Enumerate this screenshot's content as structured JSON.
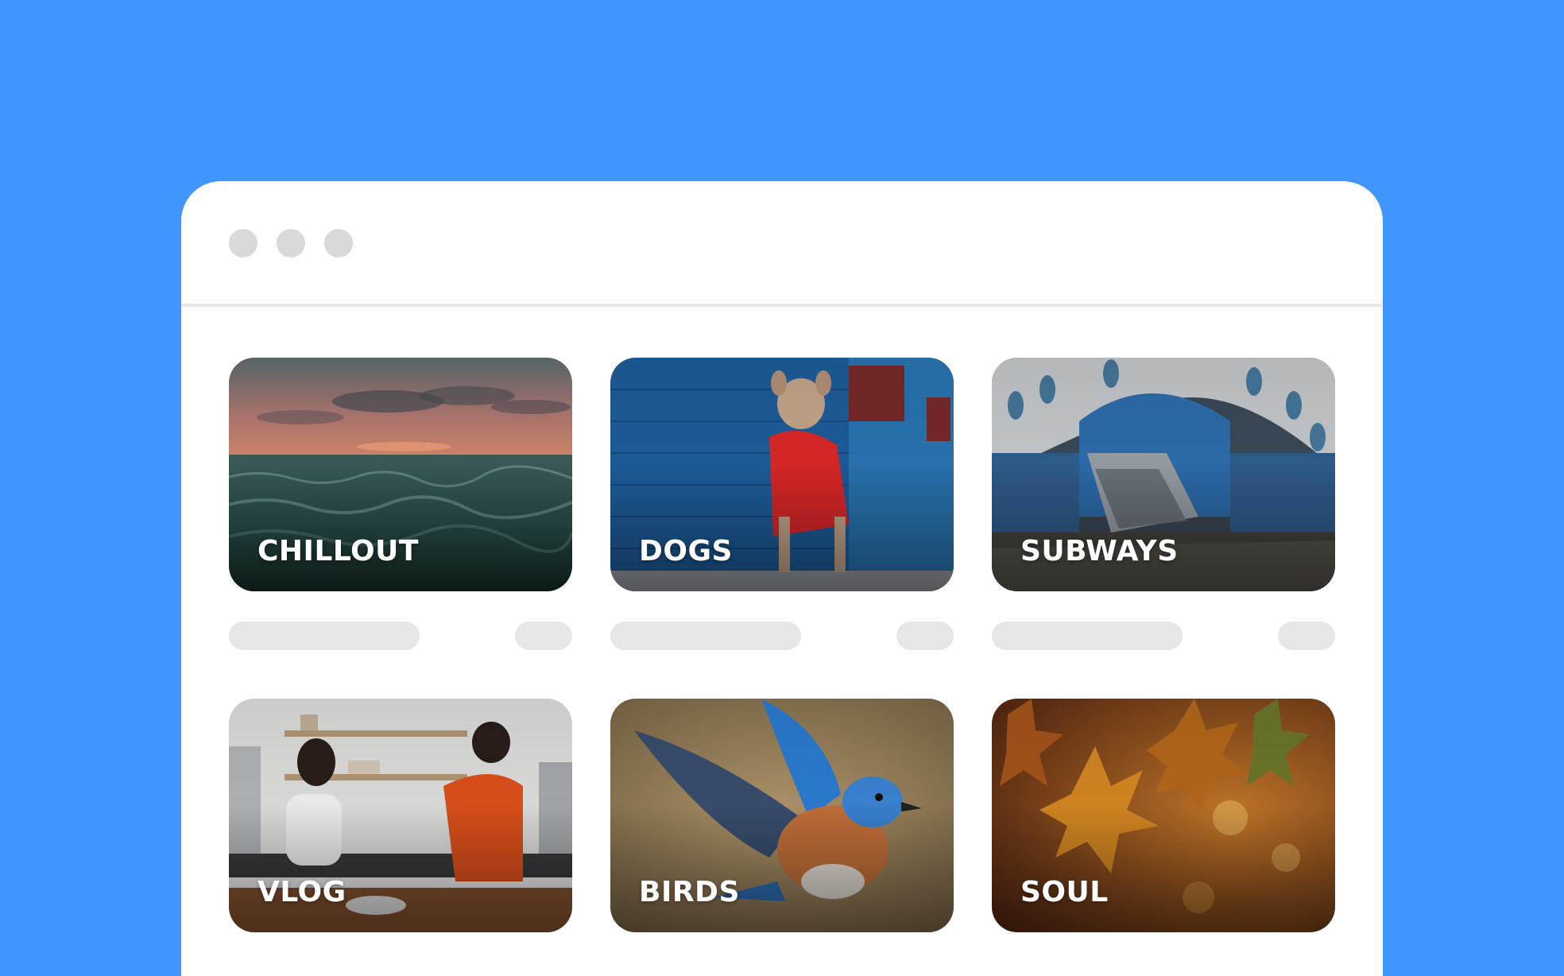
{
  "window": {
    "colors": {
      "background": "#4095FF",
      "window": "#FFFFFF",
      "placeholder": "#E7E7EA",
      "traffic_light": "#D9D9DB"
    }
  },
  "cards": [
    {
      "label": "CHILLOUT",
      "image": "ocean-sunset-waves"
    },
    {
      "label": "DOGS",
      "image": "french-bulldog-red-hoodie"
    },
    {
      "label": "SUBWAYS",
      "image": "subway-station-escalators"
    },
    {
      "label": "VLOG",
      "image": "two-people-in-kitchen"
    },
    {
      "label": "BIRDS",
      "image": "bluebird-spreading-wings"
    },
    {
      "label": "SOUL",
      "image": "autumn-leaves"
    }
  ]
}
